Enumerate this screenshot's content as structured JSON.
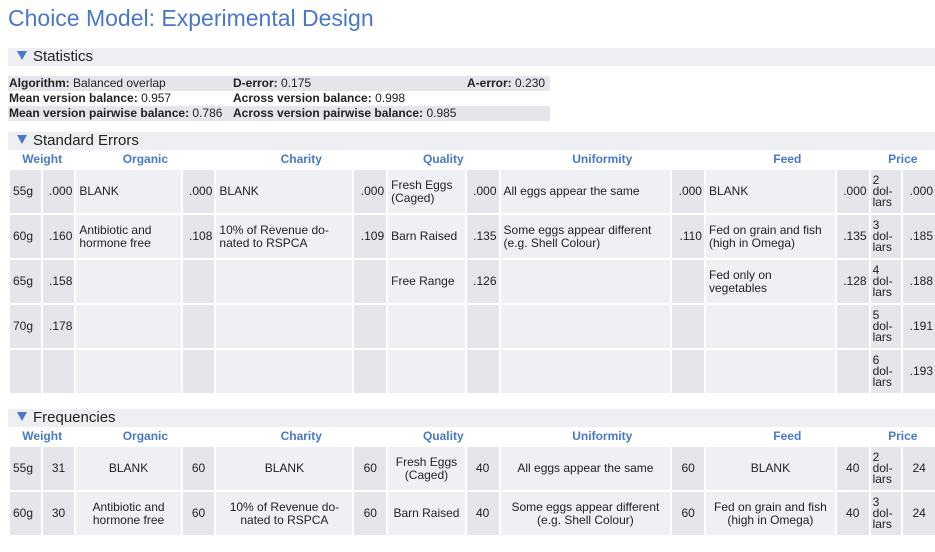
{
  "title": "Choice Model: Experimental Design",
  "sections": {
    "statistics": "Statistics",
    "standard_errors": "Standard Errors",
    "frequencies": "Frequencies"
  },
  "stats": {
    "algorithm_label": "Algorithm:",
    "algorithm_value": "Balanced overlap",
    "derror_label": "D-error:",
    "derror_value": "0.175",
    "aerror_label": "A-error:",
    "aerror_value": "0.230",
    "mvb_label": "Mean version balance:",
    "mvb_value": "0.957",
    "avb_label": "Across version balance:",
    "avb_value": "0.998",
    "mvpb_label": "Mean version pairwise balance:",
    "mvpb_value": "0.786",
    "avpb_label": "Across version pairwise balance:",
    "avpb_value": "0.985"
  },
  "headers": [
    "Weight",
    "Organic",
    "Charity",
    "Quality",
    "Uniformity",
    "Feed",
    "Price"
  ],
  "se_rows": [
    [
      "55g",
      ".000",
      "BLANK",
      ".000",
      "BLANK",
      ".000",
      "Fresh Eggs (Caged)",
      ".000",
      "All eggs appear the same",
      ".000",
      "BLANK",
      ".000",
      "2 dol-lars",
      ".000"
    ],
    [
      "60g",
      ".160",
      "Antibiotic and hormone free",
      ".108",
      "10% of Revenue do-nated to RSPCA",
      ".109",
      "Barn Raised",
      ".135",
      "Some eggs appear different (e.g. Shell Colour)",
      ".110",
      "Fed on grain and fish (high in Omega)",
      ".135",
      "3 dol-lars",
      ".185"
    ],
    [
      "65g",
      ".158",
      "",
      "",
      "",
      "",
      "Free Range",
      ".126",
      "",
      "",
      "Fed only on vegetables",
      ".128",
      "4 dol-lars",
      ".188"
    ],
    [
      "70g",
      ".178",
      "",
      "",
      "",
      "",
      "",
      "",
      "",
      "",
      "",
      "",
      "5 dol-lars",
      ".191"
    ],
    [
      "",
      "",
      "",
      "",
      "",
      "",
      "",
      "",
      "",
      "",
      "",
      "",
      "6 dol-lars",
      ".193"
    ]
  ],
  "freq_rows": [
    [
      "55g",
      "31",
      "BLANK",
      "60",
      "BLANK",
      "60",
      "Fresh Eggs (Caged)",
      "40",
      "All eggs appear the same",
      "60",
      "BLANK",
      "40",
      "2 dol-lars",
      "24"
    ],
    [
      "60g",
      "30",
      "Antibiotic and hormone free",
      "60",
      "10% of Revenue do-nated to RSPCA",
      "60",
      "Barn Raised",
      "40",
      "Some eggs appear different (e.g. Shell Colour)",
      "60",
      "Fed on grain and fish (high in Omega)",
      "40",
      "3 dol-lars",
      "24"
    ]
  ]
}
